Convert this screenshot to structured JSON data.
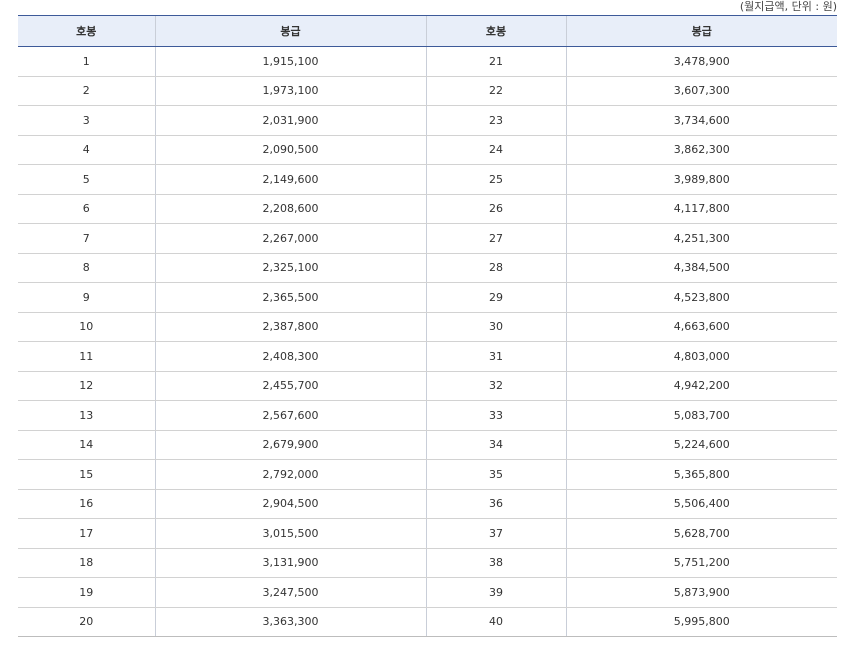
{
  "note": "(월지급액, 단위 : 원)",
  "table": {
    "headers": [
      "호봉",
      "봉급",
      "호봉",
      "봉급"
    ],
    "rows": [
      [
        "1",
        "1,915,100",
        "21",
        "3,478,900"
      ],
      [
        "2",
        "1,973,100",
        "22",
        "3,607,300"
      ],
      [
        "3",
        "2,031,900",
        "23",
        "3,734,600"
      ],
      [
        "4",
        "2,090,500",
        "24",
        "3,862,300"
      ],
      [
        "5",
        "2,149,600",
        "25",
        "3,989,800"
      ],
      [
        "6",
        "2,208,600",
        "26",
        "4,117,800"
      ],
      [
        "7",
        "2,267,000",
        "27",
        "4,251,300"
      ],
      [
        "8",
        "2,325,100",
        "28",
        "4,384,500"
      ],
      [
        "9",
        "2,365,500",
        "29",
        "4,523,800"
      ],
      [
        "10",
        "2,387,800",
        "30",
        "4,663,600"
      ],
      [
        "11",
        "2,408,300",
        "31",
        "4,803,000"
      ],
      [
        "12",
        "2,455,700",
        "32",
        "4,942,200"
      ],
      [
        "13",
        "2,567,600",
        "33",
        "5,083,700"
      ],
      [
        "14",
        "2,679,900",
        "34",
        "5,224,600"
      ],
      [
        "15",
        "2,792,000",
        "35",
        "5,365,800"
      ],
      [
        "16",
        "2,904,500",
        "36",
        "5,506,400"
      ],
      [
        "17",
        "3,015,500",
        "37",
        "5,628,700"
      ],
      [
        "18",
        "3,131,900",
        "38",
        "5,751,200"
      ],
      [
        "19",
        "3,247,500",
        "39",
        "5,873,900"
      ],
      [
        "20",
        "3,363,300",
        "40",
        "5,995,800"
      ]
    ]
  },
  "colors": {
    "header_background": "#e8eef9",
    "header_rule": "#3d5a99",
    "row_rule": "#d2d2d2"
  }
}
